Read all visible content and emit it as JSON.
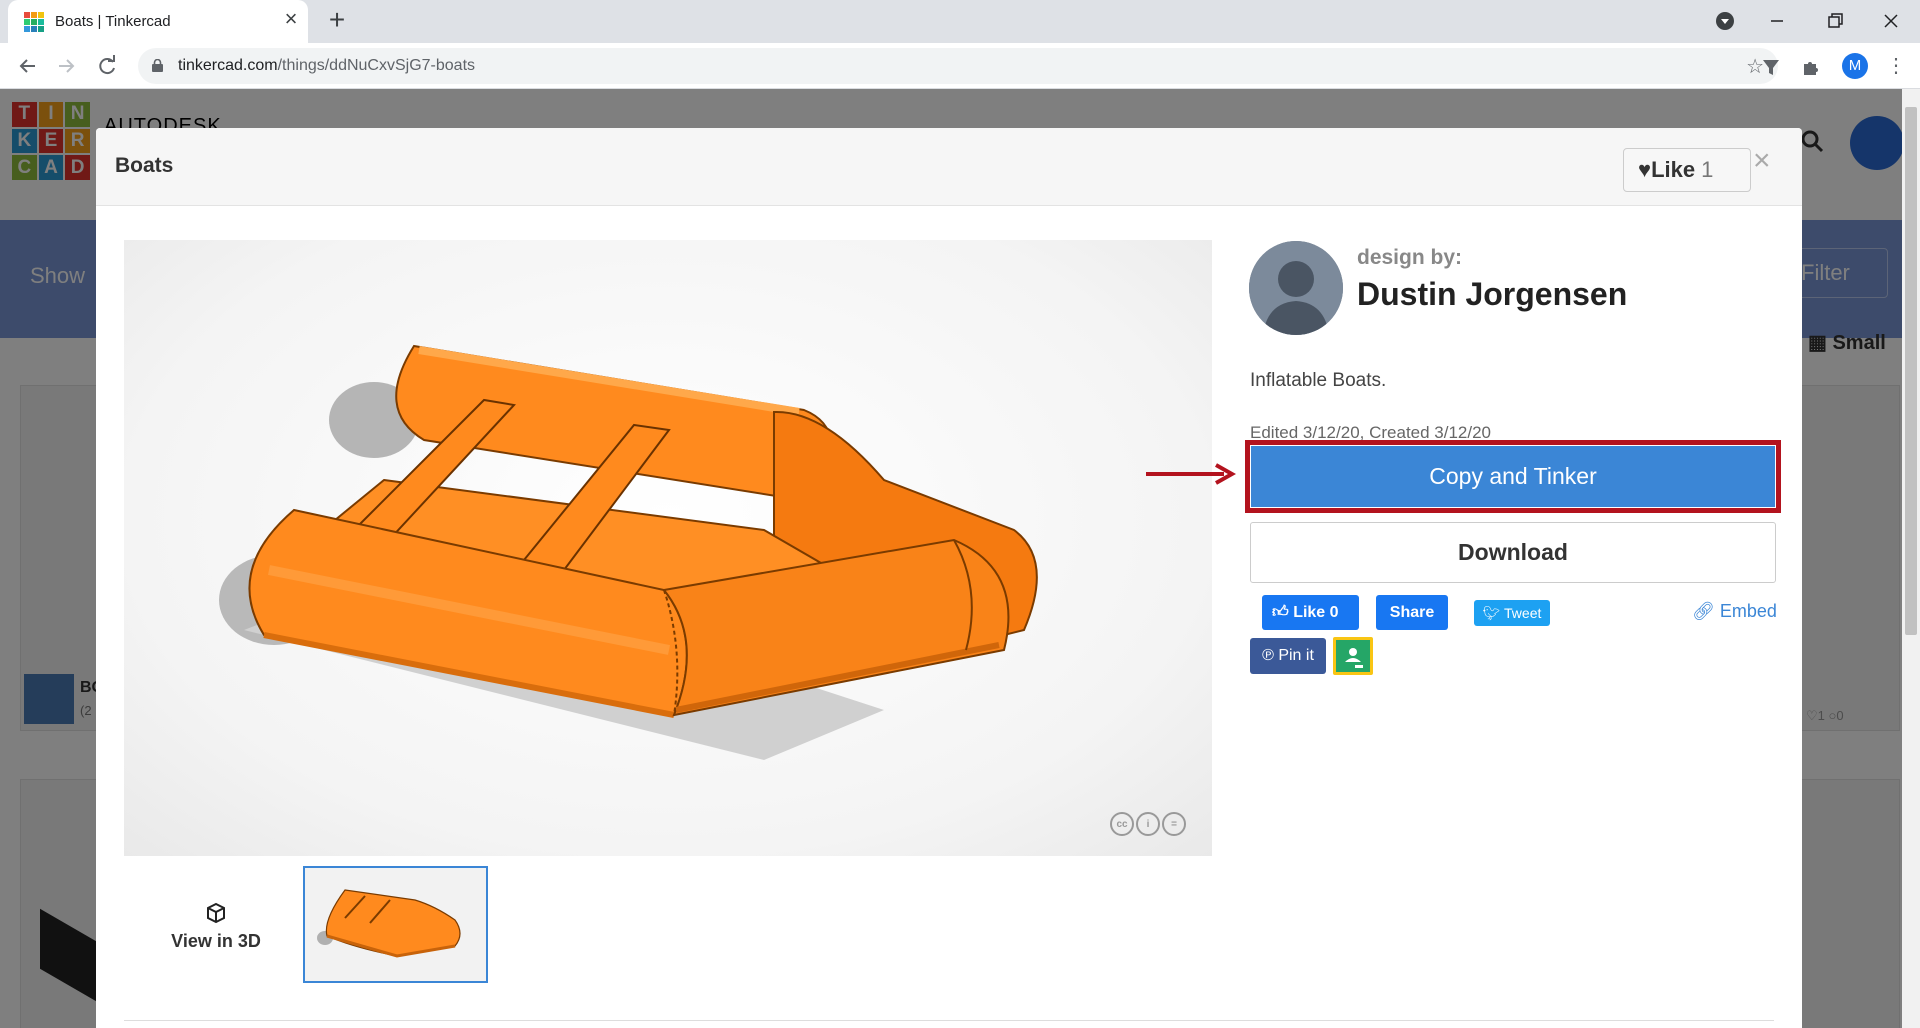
{
  "browser": {
    "tab_title": "Boats | Tinkercad",
    "url_host": "tinkercad.com",
    "url_path": "/things/ddNuCxvSjG7-boats",
    "profile_initial": "M"
  },
  "site": {
    "logo_letters": [
      "T",
      "I",
      "N",
      "K",
      "E",
      "R",
      "C",
      "A",
      "D"
    ],
    "autodesk": "AUTODESK",
    "show_label": "Show",
    "filter_label": "Filter",
    "small_label": "Small",
    "bg_card_title": "BO",
    "bg_card_sub": "(2",
    "bg_card_likes": "1",
    "bg_card_comments": "0"
  },
  "modal": {
    "title": "Boats",
    "like_label": "Like",
    "like_count": "1",
    "close_glyph": "×",
    "design_by": "design by:",
    "designer_name": "Dustin Jorgensen",
    "description": "Inflatable Boats.",
    "dates": "Edited 3/12/20, Created 3/12/20",
    "copy_button": "Copy and Tinker",
    "download_button": "Download",
    "view_in_3d": "View in 3D",
    "cc_badges": [
      "cc",
      "i",
      "="
    ]
  },
  "social": {
    "fb_like": "Like 0",
    "fb_share": "Share",
    "tweet": "Tweet",
    "embed": "Embed",
    "pin": "Pin it"
  },
  "colors": {
    "accent": "#3b86d6",
    "highlight": "#b3131e",
    "boat": "#ff8a1e",
    "facebook": "#1877f2",
    "twitter": "#1da1f2",
    "pinterest": "#3b5998",
    "classroom": "#25a667"
  },
  "icons": {
    "like": "heart-icon",
    "view3d": "cube-icon",
    "embed": "link-icon",
    "pin": "pinterest-icon",
    "classroom": "google-classroom-icon"
  }
}
